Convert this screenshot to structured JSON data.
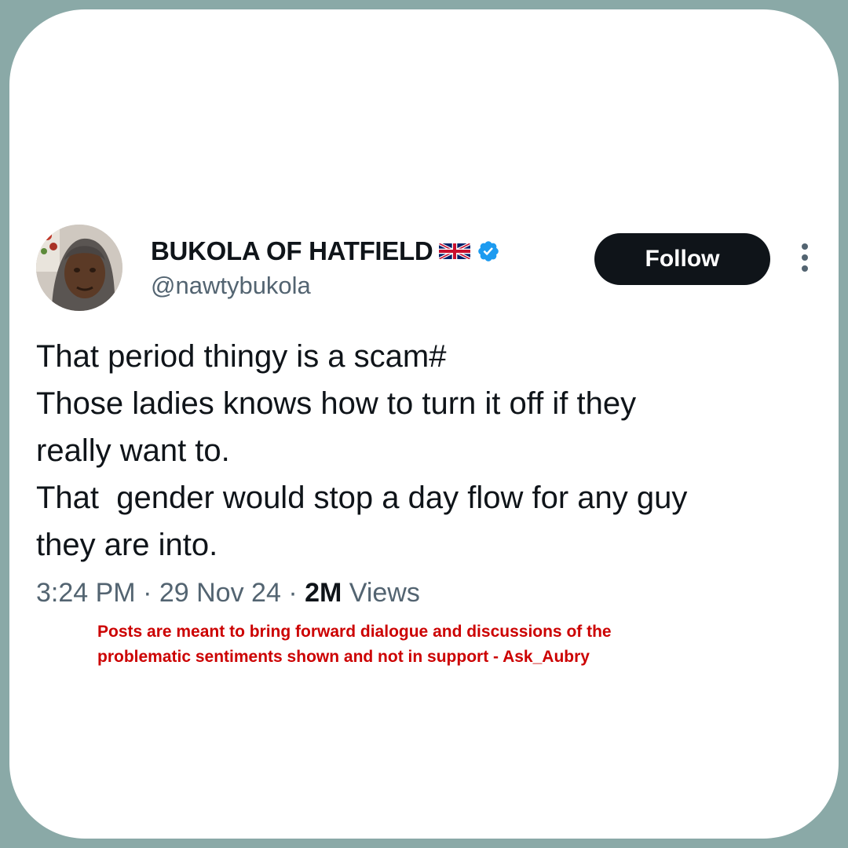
{
  "tweet": {
    "display_name": "BUKOLA OF HATFIELD",
    "flag_icon": "uk-flag-icon",
    "verified_icon": "verified-badge-icon",
    "verified_color": "#1d9bf0",
    "handle": "@nawtybukola",
    "follow_label": "Follow",
    "more_icon": "more-options-icon",
    "text_lines": [
      "That period thingy is a scam#",
      "Those ladies knows how to turn it off if they",
      "really want to.",
      "That  gender would stop a day flow for any guy",
      "they are into."
    ],
    "time": "3:24 PM",
    "separator": "·",
    "date": "29 Nov 24",
    "views_count": "2M",
    "views_label": "Views"
  },
  "disclaimer": {
    "lines": [
      "Posts are meant to bring forward dialogue and discussions of the",
      "problematic sentiments shown and not in support - Ask_Aubry"
    ],
    "color": "#cc0000"
  },
  "colors": {
    "frame_background": "#8aa9a7",
    "card_background": "#ffffff",
    "follow_button_background": "#0f1419",
    "secondary_text": "#536471"
  }
}
